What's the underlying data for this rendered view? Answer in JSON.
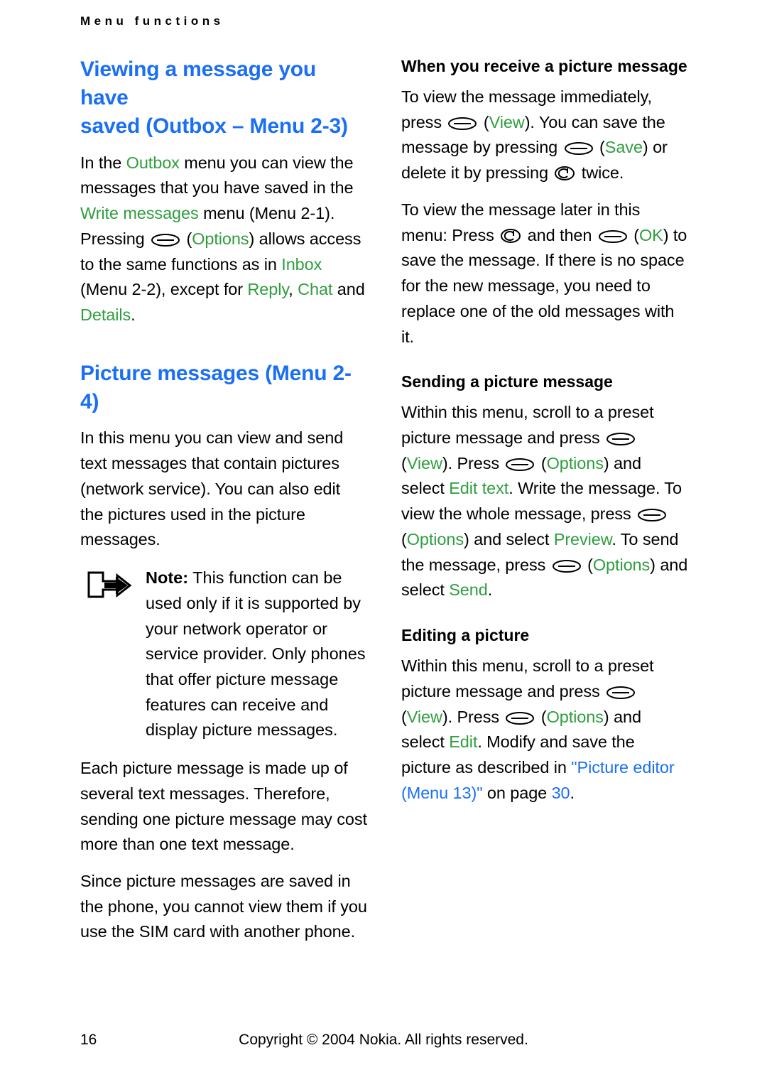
{
  "header": {
    "running_title": "Menu functions"
  },
  "left_column": {
    "heading1": {
      "part_black_1": "Viewing a message you have",
      "part_black_2": "saved (Outbox",
      "dash": " – ",
      "menu": "Menu 2-3)"
    },
    "para1": {
      "t1": "In the ",
      "g1": "Outbox",
      "t2": " menu you can view the messages that you have saved in the ",
      "g2": "Write messages",
      "t3": " menu (Menu 2-1). Pressing ",
      "t4": " (",
      "g3": "Options",
      "t5": ") allows access to the same functions as in ",
      "g4": "Inbox",
      "t6": " (Menu 2-2), except for ",
      "g5": "Reply",
      "t7": ", ",
      "g6": "Chat",
      "t8": " and ",
      "g7": "Details",
      "t9": "."
    },
    "heading2": {
      "black": "Picture messages (",
      "menu": "Menu 2-4)"
    },
    "para2": "In this menu you can view and send text messages that contain pictures (network service). You can also edit the pictures used in the picture messages.",
    "note": {
      "label": "Note:",
      "text": " This function can be used only if it is supported by your network operator or service provider. Only phones that offer picture message features can receive and display picture messages."
    },
    "para3": "Each picture message is made up of several text messages. Therefore, sending one picture message may cost more than one text message.",
    "para4": "Since picture messages are saved in the phone, you cannot view them if you use the SIM card with another phone."
  },
  "right_column": {
    "heading_receive": "When you receive a picture message",
    "para1": {
      "t1": "To view the message immediately, press ",
      "t2": " (",
      "g1": "View",
      "t3": "). You can save the message by pressing ",
      "t4": " (",
      "g2": "Save",
      "t5": ") or delete it by pressing ",
      "t6": " twice."
    },
    "para2": {
      "t1": "To view the message later in this menu: Press ",
      "t2": " and then ",
      "t3": " (",
      "g1": "OK",
      "t4": ") to save the message. If there is no space for the new message, you need to replace one of the old messages with it."
    },
    "heading_sending": "Sending a picture message",
    "para3": {
      "t1": "Within this menu, scroll to a preset picture message and press ",
      "t2": " (",
      "g1": "View",
      "t3": "). Press ",
      "t4": " (",
      "g2": "Options",
      "t5": ") and select ",
      "g3": "Edit text",
      "t6": ". Write the message. To view the whole message, press ",
      "t7": " (",
      "g4": "Options",
      "t8": ") and select ",
      "g5": "Preview",
      "t9": ". To send the message, press ",
      "t10": " (",
      "g6": "Options",
      "t11": ") and select ",
      "g7": "Send",
      "t12": "."
    },
    "heading_editing": "Editing a picture",
    "para4": {
      "t1": "Within this menu, scroll to a preset picture message and press ",
      "t2": " (",
      "g1": "View",
      "t3": "). Press ",
      "t4": " (",
      "g2": "Options",
      "t5": ") and select ",
      "g3": "Edit",
      "t6": ". Modify and save the picture as described in ",
      "b1": "\"Picture editor (Menu 13)\"",
      "t7": " on page ",
      "b2": "30",
      "t8": "."
    }
  },
  "footer": {
    "page_number": "16",
    "copyright": "Copyright © 2004 Nokia. All rights reserved."
  },
  "colors": {
    "blue": "#1b6ff5",
    "green": "#2f9e3e",
    "black": "#000000"
  }
}
